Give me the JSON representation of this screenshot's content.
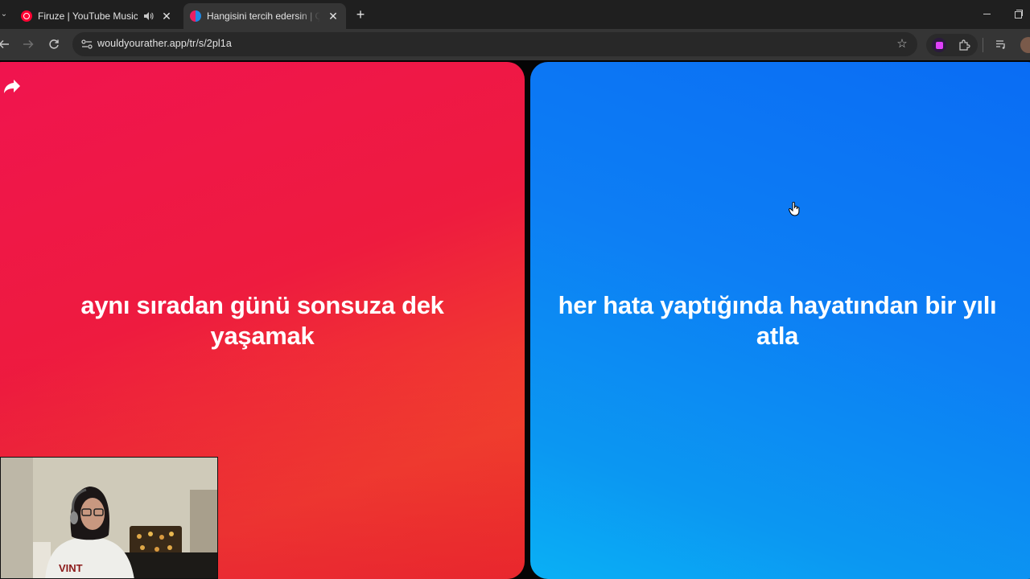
{
  "browser": {
    "tabs": [
      {
        "title": "Firuze | YouTube Music",
        "favicon": "youtube-music-icon",
        "audio": true,
        "active": false
      },
      {
        "title": "Hangisini tercih edersin | Çevrim",
        "favicon": "wouldyourather-icon",
        "audio": false,
        "active": true
      }
    ],
    "url": "wouldyourather.app/tr/s/2pl1a"
  },
  "page": {
    "option_left": {
      "text": "aynı sıradan günü sonsuza dek yaşamak",
      "color_start": "#f0144f",
      "color_end": "#ef3b20"
    },
    "option_right": {
      "text": "her hata yaptığında hayatından bir yılı atla",
      "color_start": "#0a6cf4",
      "color_end": "#0ab0f5"
    },
    "share_icon": "share-arrow-icon"
  }
}
